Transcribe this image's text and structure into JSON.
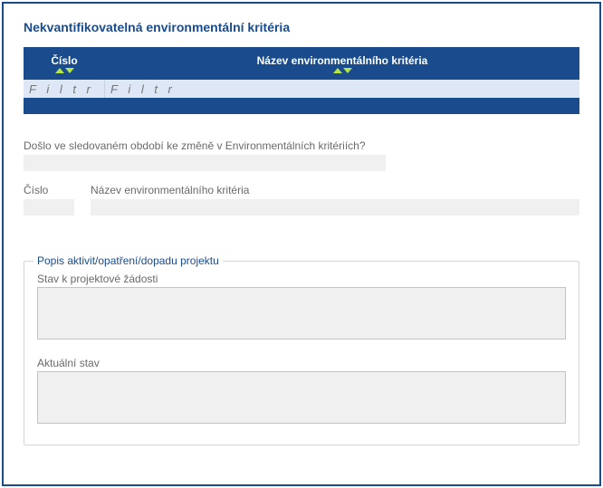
{
  "panel": {
    "title": "Nekvantifikovatelná environmentální kritéria"
  },
  "table": {
    "headers": {
      "cislo": "Číslo",
      "nazev": "Název environmentálního kritéria"
    },
    "filter_placeholder": "F i l t r"
  },
  "question": {
    "label": "Došlo ve sledovaném období ke změně v Environmentálních kritériích?",
    "value": ""
  },
  "detail": {
    "cislo_label": "Číslo",
    "cislo_value": "",
    "nazev_label": "Název environmentálního kritéria",
    "nazev_value": ""
  },
  "fieldset": {
    "legend": "Popis aktivit/opatření/dopadu projektu",
    "stav_label": "Stav k projektové žádosti",
    "stav_value": "",
    "aktualni_label": "Aktuální stav",
    "aktualni_value": ""
  }
}
